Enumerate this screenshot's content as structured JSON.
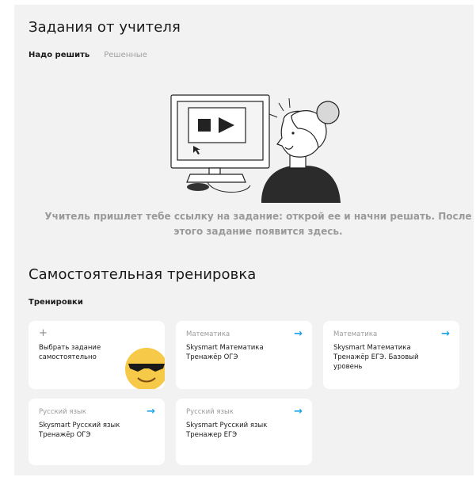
{
  "teacher": {
    "title": "Задания от учителя",
    "tabs": [
      {
        "label": "Надо решить",
        "active": true
      },
      {
        "label": "Решенные",
        "active": false
      }
    ],
    "empty_text": "Учитель пришлет тебе ссылку на задание: открой ее и начни решать. После этого задание появится здесь."
  },
  "self": {
    "title": "Самостоятельная тренировка",
    "subhead": "Тренировки",
    "cards": [
      {
        "plus": "+",
        "title": "Выбрать задание самостоятельно"
      },
      {
        "subject": "Математика",
        "title": "Skysmart Математика Тренажёр ОГЭ",
        "arrow": "→"
      },
      {
        "subject": "Математика",
        "title": "Skysmart Математика Тренажёр ЕГЭ. Базовый уровень",
        "arrow": "→"
      },
      {
        "subject": "Русский язык",
        "title": "Skysmart Русский язык Тренажёр ОГЭ",
        "arrow": "→"
      },
      {
        "subject": "Русский язык",
        "title": "Skysmart Русский язык Тренажер ЕГЭ",
        "arrow": "→"
      }
    ]
  },
  "colors": {
    "background": "#f2f2f2",
    "card": "#ffffff",
    "accent_arrow": "#1aa3e8",
    "muted_text": "#9a9a9a"
  },
  "icons": [
    "plus-icon",
    "arrow-right-icon",
    "sunglasses-emoji-icon"
  ]
}
